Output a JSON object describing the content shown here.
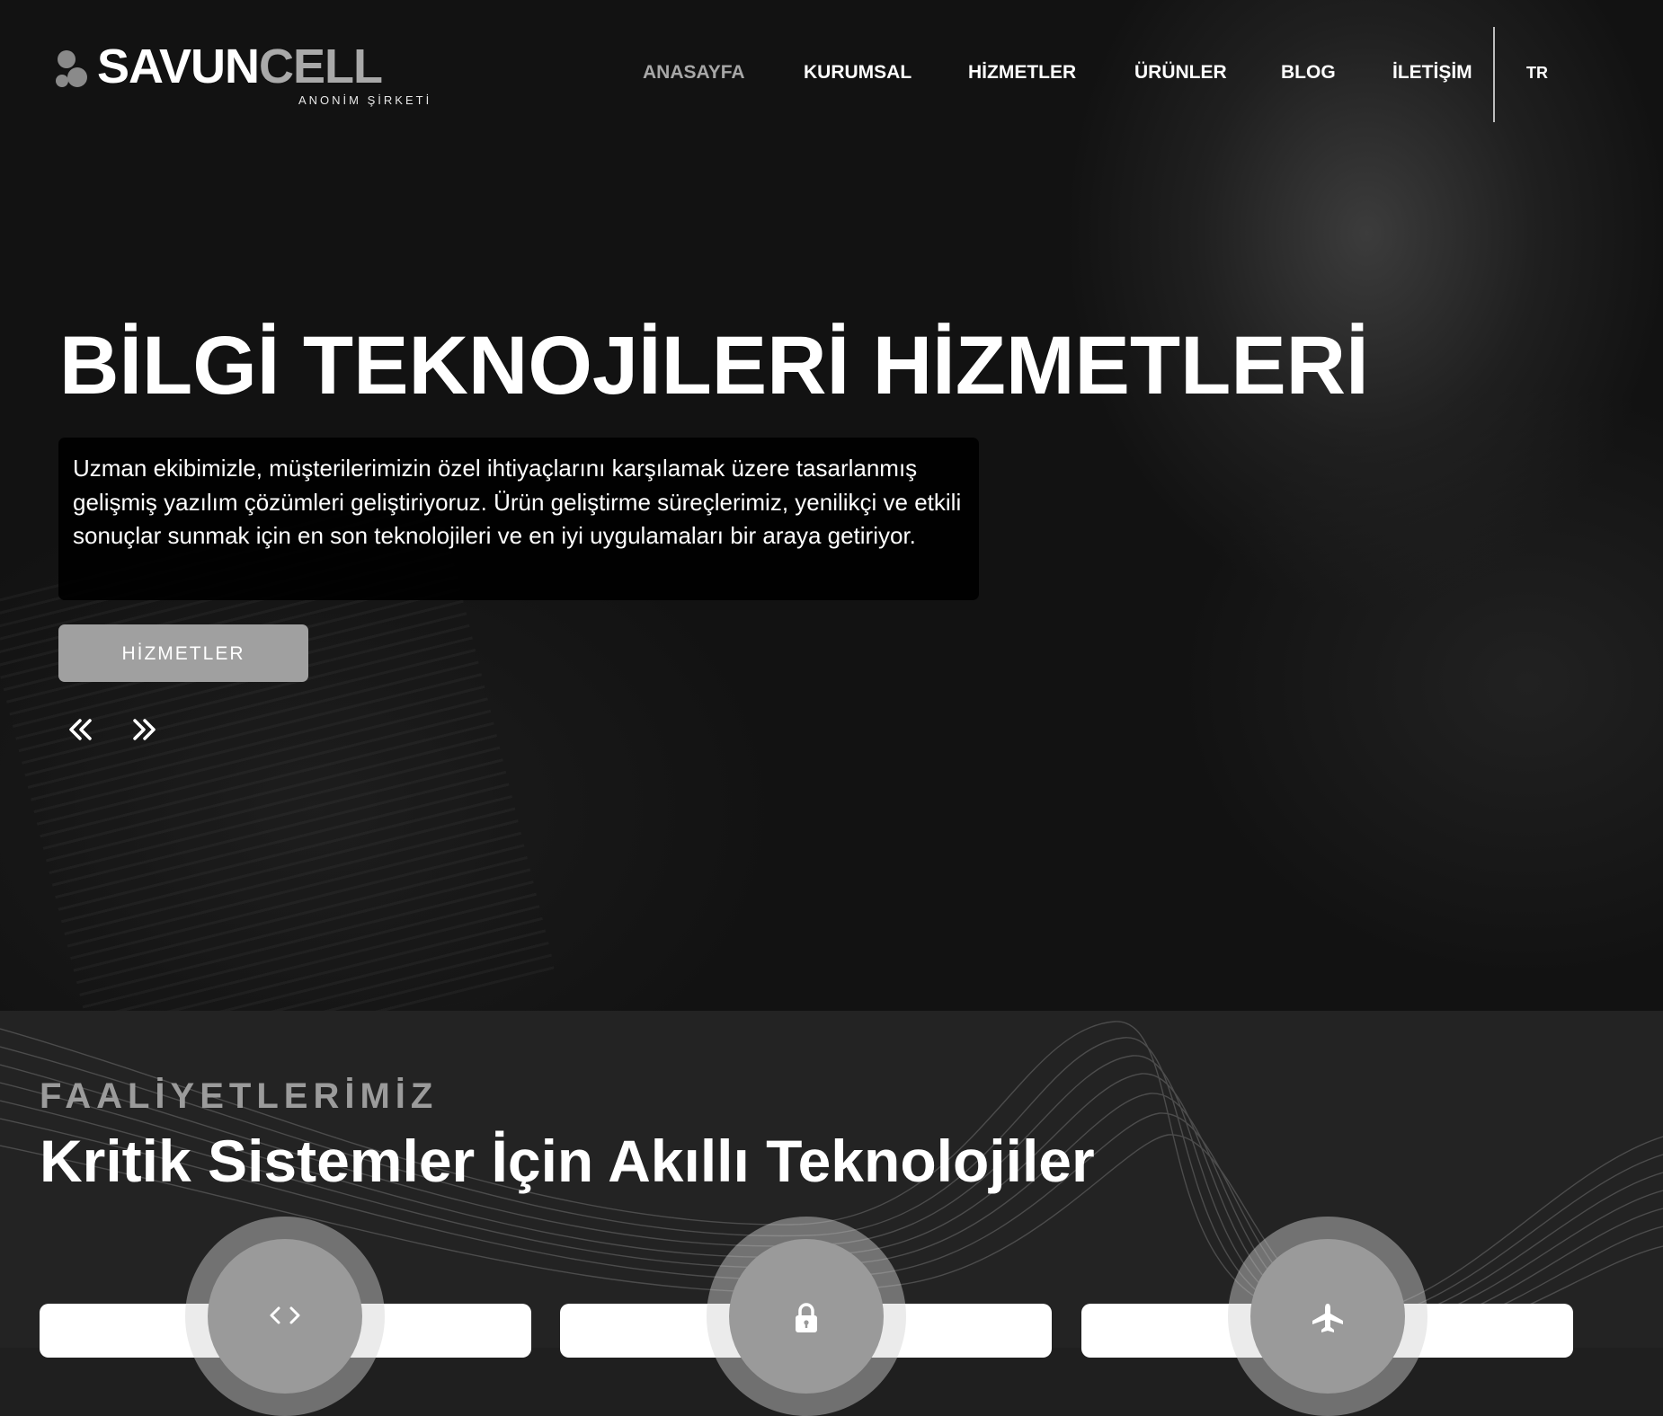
{
  "brand": {
    "name_part1": "SAVUN",
    "name_part2": "CELL",
    "subtitle": "ANONİM ŞİRKETİ"
  },
  "nav": {
    "items": [
      {
        "label": "ANASAYFA",
        "active": true
      },
      {
        "label": "KURUMSAL",
        "active": false
      },
      {
        "label": "HİZMETLER",
        "active": false
      },
      {
        "label": "ÜRÜNLER",
        "active": false
      },
      {
        "label": "BLOG",
        "active": false
      },
      {
        "label": "İLETİŞİM",
        "active": false
      }
    ],
    "language": "TR"
  },
  "hero": {
    "title": "BİLGİ TEKNOJİLERİ HİZMETLERİ",
    "description": "Uzman ekibimizle, müşterilerimizin özel ihtiyaçlarını karşılamak üzere tasarlanmış gelişmiş yazılım çözümleri geliştiriyoruz. Ürün geliştirme süreçlerimiz, yenilikçi ve etkili sonuçlar sunmak için en son teknolojileri ve en iyi uygulamaları bir araya getiriyor.",
    "button_label": "HİZMETLER",
    "prev_icon": "double-chevron-left-icon",
    "next_icon": "double-chevron-right-icon"
  },
  "activities": {
    "eyebrow": "FAALİYETLERİMİZ",
    "title": "Kritik Sistemler İçin Akıllı Teknolojiler",
    "cards": [
      {
        "icon": "code-icon"
      },
      {
        "icon": "lock-icon"
      },
      {
        "icon": "airplane-icon"
      }
    ]
  },
  "colors": {
    "accent_gray": "#a0a0a0",
    "active_nav": "#a7a7a7",
    "section_bg": "#232323",
    "hero_bg": "#121212"
  }
}
